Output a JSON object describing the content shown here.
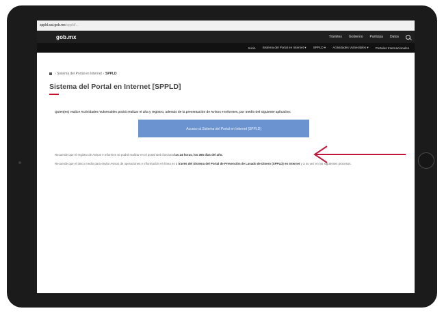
{
  "browser": {
    "host": "sppld.sat.gob.mx",
    "path": "/sppld/..."
  },
  "header": {
    "logo": "gob.mx",
    "links": [
      "Trámites",
      "Gobierno",
      "Participa",
      "Datos"
    ]
  },
  "nav": {
    "items": [
      "Inicio",
      "Sistema del Portal en Internet ▾",
      "SPPLD ▾",
      "Actividades Vulnerables ▾",
      "Portales Internacionales"
    ]
  },
  "breadcrumb": {
    "prefix": "› Sistema del Portal en Internet ›",
    "current": "SPPLD"
  },
  "page": {
    "title": "Sistema del Portal en Internet [SPPLD]",
    "intro": "Quien(es) realice Actividades Vulnerables podrá realizar el alta y registro, además de la presentación de Avisos e Informes, por medio del siguiente aplicativo:",
    "button": "Acceso al Sistema del Portal en Internet [SPPLD]",
    "note1_text": "Recuerde que el registro de Avisos e Informes se podrá realizar en el portal web funciona",
    "note1_bold": "las 24 horas, los 365 días del año.",
    "note2_text": "Recuerde que el único medio para enviar Avisos de operaciones e información en línea es a",
    "note2_bold": "través del Sistema del Portal de Prevención de Lavado de Dinero (SPPLD) en Internet",
    "note2_tail": "y a su vez en los siguientes procesos."
  },
  "annotation": {
    "arrow_color": "#c0163a"
  }
}
